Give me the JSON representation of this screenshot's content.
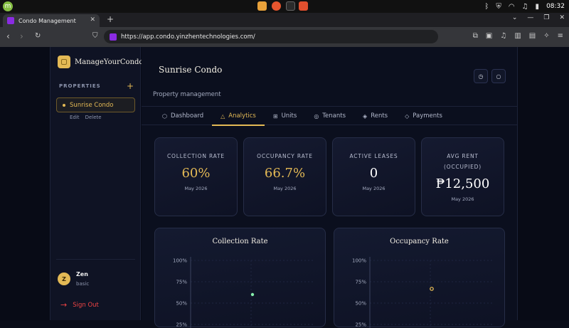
{
  "browser": {
    "tab_title": "Condo Management",
    "url": "https://app.condo.yinzhentechnologies.com/",
    "clock": "08:32"
  },
  "sidebar": {
    "brand": "ManageYourCondo",
    "properties_header": "PROPERTIES",
    "add_symbol": "+",
    "selected_property": "Sunrise Condo",
    "edit_label": "Edit",
    "delete_label": "Delete",
    "user": {
      "initial": "Z",
      "name": "Zen",
      "plan": "basic"
    },
    "sign_out_label": "Sign Out"
  },
  "header": {
    "title": "Sunrise Condo",
    "subtitle": "Property management"
  },
  "tabs": [
    {
      "label": "Dashboard",
      "icon": "hexagon-icon",
      "glyph": "⬡"
    },
    {
      "label": "Analytics",
      "icon": "triangle-icon",
      "glyph": "△"
    },
    {
      "label": "Units",
      "icon": "grid-icon",
      "glyph": "⊞"
    },
    {
      "label": "Tenants",
      "icon": "circle-dot-icon",
      "glyph": "◎"
    },
    {
      "label": "Rents",
      "icon": "diamond-icon",
      "glyph": "◈"
    },
    {
      "label": "Payments",
      "icon": "diamond-outline-icon",
      "glyph": "◇"
    }
  ],
  "active_tab": "Analytics",
  "kpis": [
    {
      "label": "COLLECTION RATE",
      "value": "60%",
      "date": "May 2026",
      "color": "#e3b955"
    },
    {
      "label": "OCCUPANCY RATE",
      "value": "66.7%",
      "date": "May 2026",
      "color": "#e3b955"
    },
    {
      "label": "ACTIVE LEASES",
      "value": "0",
      "date": "May 2026",
      "color": "#ffffff"
    },
    {
      "label": "AVG RENT (OCCUPIED)",
      "value": "₱12,500",
      "date": "May 2026",
      "color": "#ffffff"
    }
  ],
  "colors": {
    "accent": "#e3b955",
    "green": "#86efac",
    "danger": "#ef4444"
  },
  "chart_data": [
    {
      "type": "scatter",
      "title": "Collection Rate",
      "ylim": [
        0,
        100
      ],
      "yticks": [
        "100%",
        "75%",
        "50%",
        "25%"
      ],
      "points": [
        {
          "y": 60
        }
      ],
      "color": "#86efac"
    },
    {
      "type": "scatter",
      "title": "Occupancy Rate",
      "ylim": [
        0,
        100
      ],
      "yticks": [
        "100%",
        "75%",
        "50%",
        "25%"
      ],
      "points": [
        {
          "y": 66.7
        }
      ],
      "color": "#e3b955"
    }
  ]
}
